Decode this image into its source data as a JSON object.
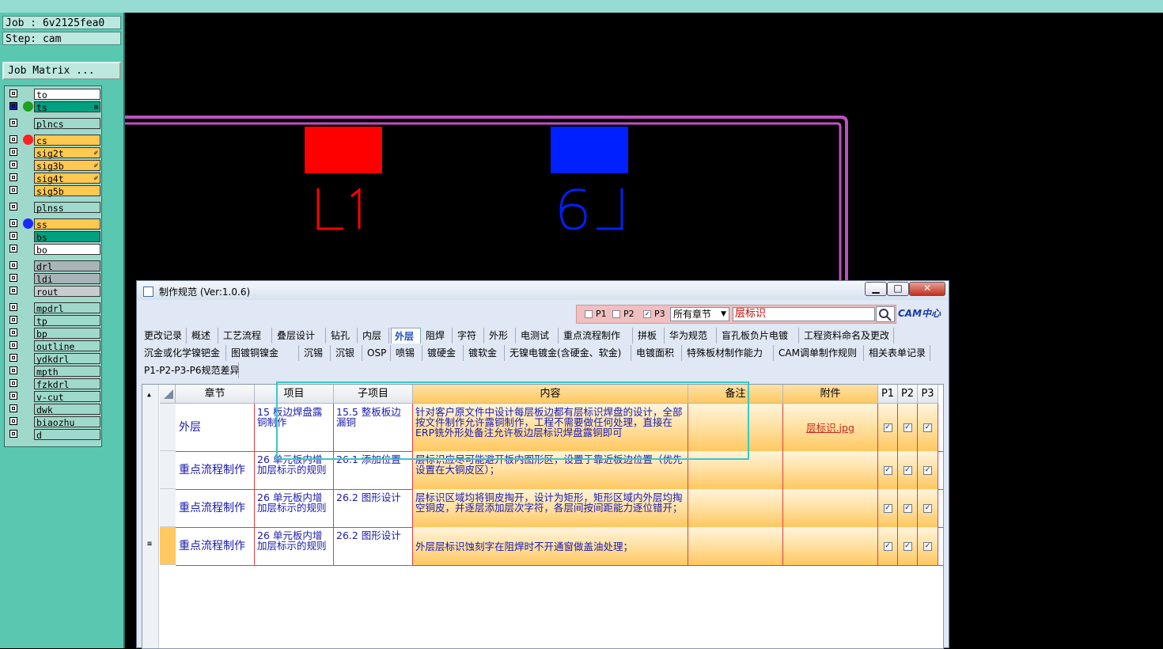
{
  "job": {
    "label": "Job : 6v2125fea0",
    "step": "Step: cam",
    "matrix_button": "Job Matrix ..."
  },
  "layers": [
    {
      "name": "to",
      "color": "#ffffff",
      "dot": "",
      "checkbox": "white"
    },
    {
      "name": "ts",
      "color": "#00a080",
      "dot": "#20a020",
      "checkbox": "blue",
      "flag": "⊞"
    },
    {
      "name": "plncs",
      "color": "#9fd9cc",
      "dot": "",
      "checkbox": "white"
    },
    {
      "name": "cs",
      "color": "#ffc850",
      "dot": "#ff2020",
      "checkbox": "white"
    },
    {
      "name": "sig2t",
      "color": "#ffc850",
      "dot": "",
      "checkbox": "white",
      "flag": "✐"
    },
    {
      "name": "sig3b",
      "color": "#ffc850",
      "dot": "",
      "checkbox": "white",
      "flag": "✐"
    },
    {
      "name": "sig4t",
      "color": "#ffc850",
      "dot": "",
      "checkbox": "white",
      "flag": "✐"
    },
    {
      "name": "sig5b",
      "color": "#ffc850",
      "dot": "",
      "checkbox": "white"
    },
    {
      "name": "plnss",
      "color": "#9fd9cc",
      "dot": "",
      "checkbox": "white"
    },
    {
      "name": "ss",
      "color": "#ffc850",
      "dot": "#1a2aff",
      "checkbox": "white"
    },
    {
      "name": "bs",
      "color": "#00a080",
      "dot": "",
      "checkbox": "white"
    },
    {
      "name": "bo",
      "color": "#ffffff",
      "dot": "",
      "checkbox": "white"
    },
    {
      "name": "drl",
      "color": "#a8b4b8",
      "dot": "",
      "checkbox": "white"
    },
    {
      "name": "ldi",
      "color": "#a8b4b8",
      "dot": "",
      "checkbox": "white"
    },
    {
      "name": "rout",
      "color": "#c8ccd0",
      "dot": "",
      "checkbox": "white"
    },
    {
      "name": "mpdrl",
      "color": "#9fd9cc",
      "dot": "",
      "checkbox": "white"
    },
    {
      "name": "tp",
      "color": "#9fd9cc",
      "dot": "",
      "checkbox": "white"
    },
    {
      "name": "bp",
      "color": "#9fd9cc",
      "dot": "",
      "checkbox": "white"
    },
    {
      "name": "outline",
      "color": "#9fd9cc",
      "dot": "",
      "checkbox": "white"
    },
    {
      "name": "ydkdrl",
      "color": "#9fd9cc",
      "dot": "",
      "checkbox": "white"
    },
    {
      "name": "mpth",
      "color": "#9fd9cc",
      "dot": "",
      "checkbox": "white"
    },
    {
      "name": "fzkdrl",
      "color": "#9fd9cc",
      "dot": "",
      "checkbox": "white"
    },
    {
      "name": "v-cut",
      "color": "#9fd9cc",
      "dot": "",
      "checkbox": "white"
    },
    {
      "name": "dwk",
      "color": "#9fd9cc",
      "dot": "",
      "checkbox": "white"
    },
    {
      "name": "biaozhu",
      "color": "#9fd9cc",
      "dot": "",
      "checkbox": "white"
    },
    {
      "name": "d",
      "color": "#9fd9cc",
      "dot": "",
      "checkbox": "white"
    }
  ],
  "canvas": {
    "label_left": "L1",
    "label_right": "L6",
    "pad_left_color": "#ff0000",
    "pad_right_color": "#0020ff",
    "outline_color": "#c050c0"
  },
  "dialog": {
    "title": "制作规范 (Ver:1.0.6)",
    "minimize": "▁",
    "maximize": "□",
    "close": "✕",
    "filters": [
      {
        "label": "P1",
        "checked": false
      },
      {
        "label": "P2",
        "checked": false
      },
      {
        "label": "P3",
        "checked": true
      }
    ],
    "chapter_select": "所有章节",
    "search_value": "层标识",
    "logo": "CAM中心",
    "tabs_row1": [
      "更改记录",
      "概述",
      "工艺流程",
      "叠层设计",
      "钻孔",
      "内层",
      "外层",
      "阻焊",
      "字符",
      "外形",
      "电测试",
      "重点流程制作",
      "拼板",
      "华为规范",
      "盲孔板负片电镀",
      "工程资料命名及更改"
    ],
    "tabs_row2": [
      "沉金或化学镍钯金",
      "图镀铜镍金",
      "沉锡",
      "沉银",
      "OSP",
      "喷锡",
      "镀硬金",
      "镀软金",
      "无镍电镀金(含硬金、软金)",
      "电镀面积",
      "特殊板材制作能力",
      "CAM调单制作规则",
      "相关表单记录"
    ],
    "tabs_row3": [
      "P1-P2-P3-P6规范差异"
    ],
    "active_tab": "外层",
    "columns": [
      "章节",
      "项目",
      "子项目",
      "内容",
      "备注",
      "附件",
      "P1",
      "P2",
      "P3"
    ],
    "rows": [
      {
        "chapter": "外层",
        "item": "15 板边焊盘露铜制作",
        "subitem": "15.5 整板板边漏铜",
        "content": "针对客户原文件中设计每层板边都有层标识焊盘的设计，全部按文件制作允许露铜制作，工程不需要做任何处理，直接在ERP铣外形处备注允许板边层标识焊盘露铜即可",
        "note": "",
        "attachment": "层标识.jpg",
        "p1": true,
        "p2": true,
        "p3": true
      },
      {
        "chapter": "重点流程制作",
        "item": "26 单元板内增加层标示的规则",
        "subitem": "26.1 添加位置",
        "content": "层标识应尽可能避开板内图形区，设置于靠近板边位置（优先设置在大铜皮区）；",
        "note": "",
        "attachment": "",
        "p1": true,
        "p2": true,
        "p3": true
      },
      {
        "chapter": "重点流程制作",
        "item": "26 单元板内增加层标示的规则",
        "subitem": "26.2 图形设计",
        "content": "层标识区域均将铜皮掏开，设计为矩形，矩形区域内外层均掏空铜皮，并逐层添加层次字符，各层间按间距能力逐位错开；",
        "note": "",
        "attachment": "",
        "p1": true,
        "p2": true,
        "p3": true
      },
      {
        "chapter": "重点流程制作",
        "item": "26 单元板内增加层标示的规则",
        "subitem": "26.2 图形设计",
        "content": "外层层标识蚀刻字在阻焊时不开通窗做盖油处理；",
        "note": "",
        "attachment": "",
        "p1": true,
        "p2": true,
        "p3": true
      }
    ]
  }
}
